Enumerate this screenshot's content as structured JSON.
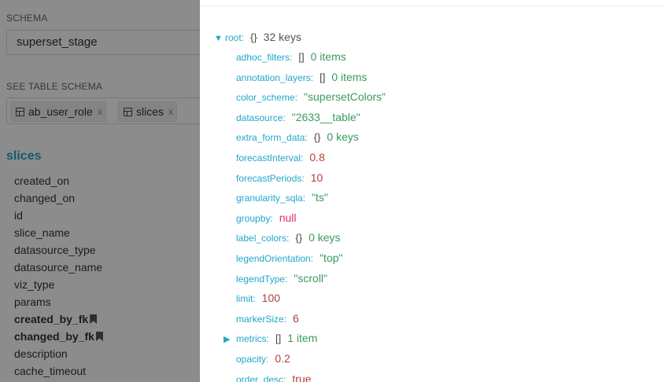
{
  "sidebar": {
    "schema_label": "SCHEMA",
    "schema_value": "superset_stage",
    "see_table_label": "SEE TABLE SCHEMA",
    "tags": [
      {
        "label": "ab_user_role",
        "remove": "x"
      },
      {
        "label": "slices",
        "remove": "x"
      }
    ],
    "table_title": "slices",
    "columns": [
      {
        "name": "created_on",
        "fk": false
      },
      {
        "name": "changed_on",
        "fk": false
      },
      {
        "name": "id",
        "fk": false
      },
      {
        "name": "slice_name",
        "fk": false
      },
      {
        "name": "datasource_type",
        "fk": false
      },
      {
        "name": "datasource_name",
        "fk": false
      },
      {
        "name": "viz_type",
        "fk": false
      },
      {
        "name": "params",
        "fk": false
      },
      {
        "name": "created_by_fk",
        "fk": true
      },
      {
        "name": "changed_by_fk",
        "fk": true
      },
      {
        "name": "description",
        "fk": false
      },
      {
        "name": "cache_timeout",
        "fk": false
      }
    ]
  },
  "json_view": {
    "root": {
      "caret": "▼",
      "key": "root",
      "brace": "{}",
      "meta": "32 keys"
    },
    "entries": [
      {
        "key": "adhoc_filters",
        "brace": "[]",
        "value": "0 items",
        "type": "meta"
      },
      {
        "key": "annotation_layers",
        "brace": "[]",
        "value": "0 items",
        "type": "meta"
      },
      {
        "key": "color_scheme",
        "brace": "",
        "value": "\"supersetColors\"",
        "type": "str"
      },
      {
        "key": "datasource",
        "brace": "",
        "value": "\"2633__table\"",
        "type": "str"
      },
      {
        "key": "extra_form_data",
        "brace": "{}",
        "value": "0 keys",
        "type": "meta"
      },
      {
        "key": "forecastInterval",
        "brace": "",
        "value": "0.8",
        "type": "num"
      },
      {
        "key": "forecastPeriods",
        "brace": "",
        "value": "10",
        "type": "num"
      },
      {
        "key": "granularity_sqla",
        "brace": "",
        "value": "\"ts\"",
        "type": "str"
      },
      {
        "key": "groupby",
        "brace": "",
        "value": "null",
        "type": "null"
      },
      {
        "key": "label_colors",
        "brace": "{}",
        "value": "0 keys",
        "type": "meta"
      },
      {
        "key": "legendOrientation",
        "brace": "",
        "value": "\"top\"",
        "type": "str"
      },
      {
        "key": "legendType",
        "brace": "",
        "value": "\"scroll\"",
        "type": "str"
      },
      {
        "key": "limit",
        "brace": "",
        "value": "100",
        "type": "num"
      },
      {
        "key": "markerSize",
        "brace": "",
        "value": "6",
        "type": "num"
      },
      {
        "key": "metrics",
        "brace": "[]",
        "value": "1 item",
        "type": "meta",
        "caret": "▶"
      },
      {
        "key": "opacity",
        "brace": "",
        "value": "0.2",
        "type": "num"
      },
      {
        "key": "order_desc",
        "brace": "",
        "value": "true",
        "type": "bool"
      }
    ]
  },
  "colors": {
    "key": "#20a7c9",
    "string": "#3a9a5c",
    "number": "#b0413e",
    "null": "#e0306a",
    "overlay": "rgba(0,0,0,0.45)"
  }
}
